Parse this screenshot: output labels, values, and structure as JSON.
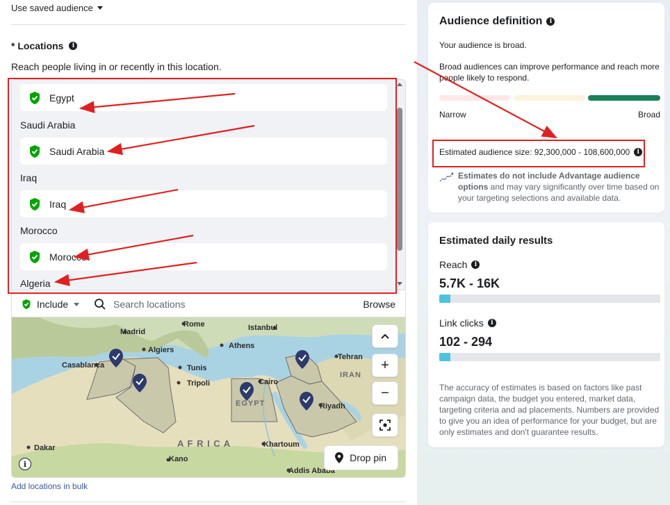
{
  "audience_selector": {
    "label": "Use saved audience"
  },
  "locations": {
    "title": "* Locations",
    "subtitle": "Reach people living in or recently in this location.",
    "entries": [
      {
        "group": "",
        "name": "Egypt"
      },
      {
        "group": "Saudi Arabia",
        "name": "Saudi Arabia"
      },
      {
        "group": "Iraq",
        "name": "Iraq"
      },
      {
        "group": "Morocco",
        "name": "Morocco"
      },
      {
        "group": "Algeria",
        "name": ""
      }
    ],
    "include_label": "Include",
    "search_placeholder": "Search locations",
    "browse_label": "Browse",
    "drop_pin_label": "Drop pin",
    "bulk_link": "Add locations in bulk"
  },
  "map": {
    "labels": {
      "madrid": "Madrid",
      "rome": "Rome",
      "istanbul": "Istanbul",
      "algiers": "Algiers",
      "athens": "Athens",
      "casablanca": "Casablanca",
      "tunis": "Tunis",
      "tripoli": "Tripoli",
      "tehran": "Tehran",
      "iran": "IRAN",
      "cairo": "Cairo",
      "egypt": "EGYPT",
      "riyadh": "Riyadh",
      "africa": "A F R I C A",
      "dakar": "Dakar",
      "khartoum": "Khartoum",
      "kano": "Kano",
      "addis": "Addis Ababa"
    },
    "zoom_in": "+",
    "zoom_out": "−"
  },
  "audience_definition": {
    "title": "Audience definition",
    "status": "Your audience is broad.",
    "description": "Broad audiences can improve performance and reach more people likely to respond.",
    "narrow_label": "Narrow",
    "broad_label": "Broad",
    "estimated_size": "Estimated audience size: 92,300,000 - 108,600,000",
    "note_bold": "Estimates do not include Advantage audience options",
    "note_rest": " and may vary significantly over time based on your targeting selections and available data."
  },
  "daily_results": {
    "title": "Estimated daily results",
    "reach_label": "Reach",
    "reach_value": "5.7K - 16K",
    "reach_fill": 0.05,
    "clicks_label": "Link clicks",
    "clicks_value": "102 - 294",
    "clicks_fill": 0.05,
    "disclaimer": "The accuracy of estimates is based on factors like past campaign data, the budget you entered, market data, targeting criteria and ad placements. Numbers are provided to give you an idea of performance for your budget, but are only estimates and don't guarantee results."
  },
  "colors": {
    "accent_red": "#e02020",
    "check_green": "#00a400",
    "meter_broad": "#1d7f5a",
    "bar_fill": "#4ec3e0",
    "pin_navy": "#2d3a6b"
  }
}
